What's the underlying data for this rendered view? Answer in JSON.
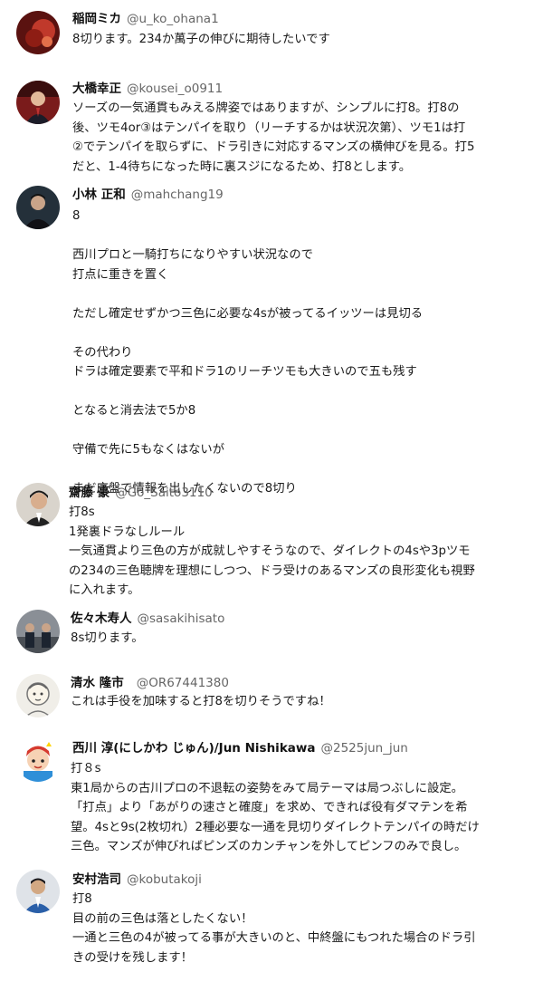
{
  "tweets": [
    {
      "name": "稲岡ミカ",
      "handle": "@u_ko_ohana1",
      "avatar": "avatar-photo-dark-red",
      "text": "8切ります。234か萬子の伸びに期待したいです"
    },
    {
      "name": "大橋幸正",
      "handle": "@kousei_o0911",
      "avatar": "avatar-photo-suit-man",
      "text": "ソーズの一気通貫もみえる牌姿ではありますが、シンプルに打8。打8の\n後、ツモ4or③はテンパイを取り（リーチするかは状況次第）、ツモ1は打\n②でテンパイを取らずに、ドラ引きに対応するマンズの横伸びを見る。打5\nだと、1-4待ちになった時に裏スジになるため、打8とします。"
    },
    {
      "name": "小林 正和",
      "handle": "@mahchang19",
      "avatar": "avatar-photo-dark-man",
      "text": "8\n\n西川プロと一騎打ちになりやすい状況なので\n打点に重きを置く\n\nただし確定せずかつ三色に必要な4sが被ってるイッツーは見切る\n\nその代わり\nドラは確定要素で平和ドラ1のリーチツモも大きいので五も残す\n\nとなると消去法で5か8\n\n守備で先に5もなくはないが\n\nまだ序盤で情報を出したくないので8切り"
    },
    {
      "name": "齋藤 豪",
      "handle": "@Go_Saito3110",
      "avatar": "avatar-photo-man-portrait",
      "text": "打8s\n1発裏ドラなしルール\n一気通貫より三色の方が成就しやすそうなので、ダイレクトの4sや3pツモ\nの234の三色聴牌を理想にしつつ、ドラ受けのあるマンズの良形変化も視野\nに入れます。"
    },
    {
      "name": "佐々木寿人",
      "handle": "@sasakihisato",
      "avatar": "avatar-photo-group",
      "text": "8s切ります。"
    },
    {
      "name": "清水 隆市",
      "handle": "@OR67441380",
      "avatar": "avatar-sketch-drawing",
      "text": "これは手役を加味すると打8を切りそうですね！"
    },
    {
      "name": "西川 淳(にしかわ じゅん)/Jun Nishikawa",
      "handle": "@2525jun_jun",
      "avatar": "avatar-cartoon-character",
      "text": "打８s\n東1局からの古川プロの不退転の姿勢をみて局テーマは局つぶしに設定。\n「打点」より「あがりの速さと確度」を求め、できれば役有ダマテンを希\n望。4sと9s(2枚切れ）2種必要な一通を見切りダイレクトテンパイの時だけ\n三色。マンズが伸びればピンズのカンチャンを外してピンフのみで良し。"
    },
    {
      "name": "安村浩司",
      "handle": "@kobutakoji",
      "avatar": "avatar-photo-man-blue-shirt",
      "text": "打8\n目の前の三色は落としたくない！\n一通と三色の4が被ってる事が大きいのと、中終盤にもつれた場合のドラ引\nきの受けを残します！"
    }
  ]
}
